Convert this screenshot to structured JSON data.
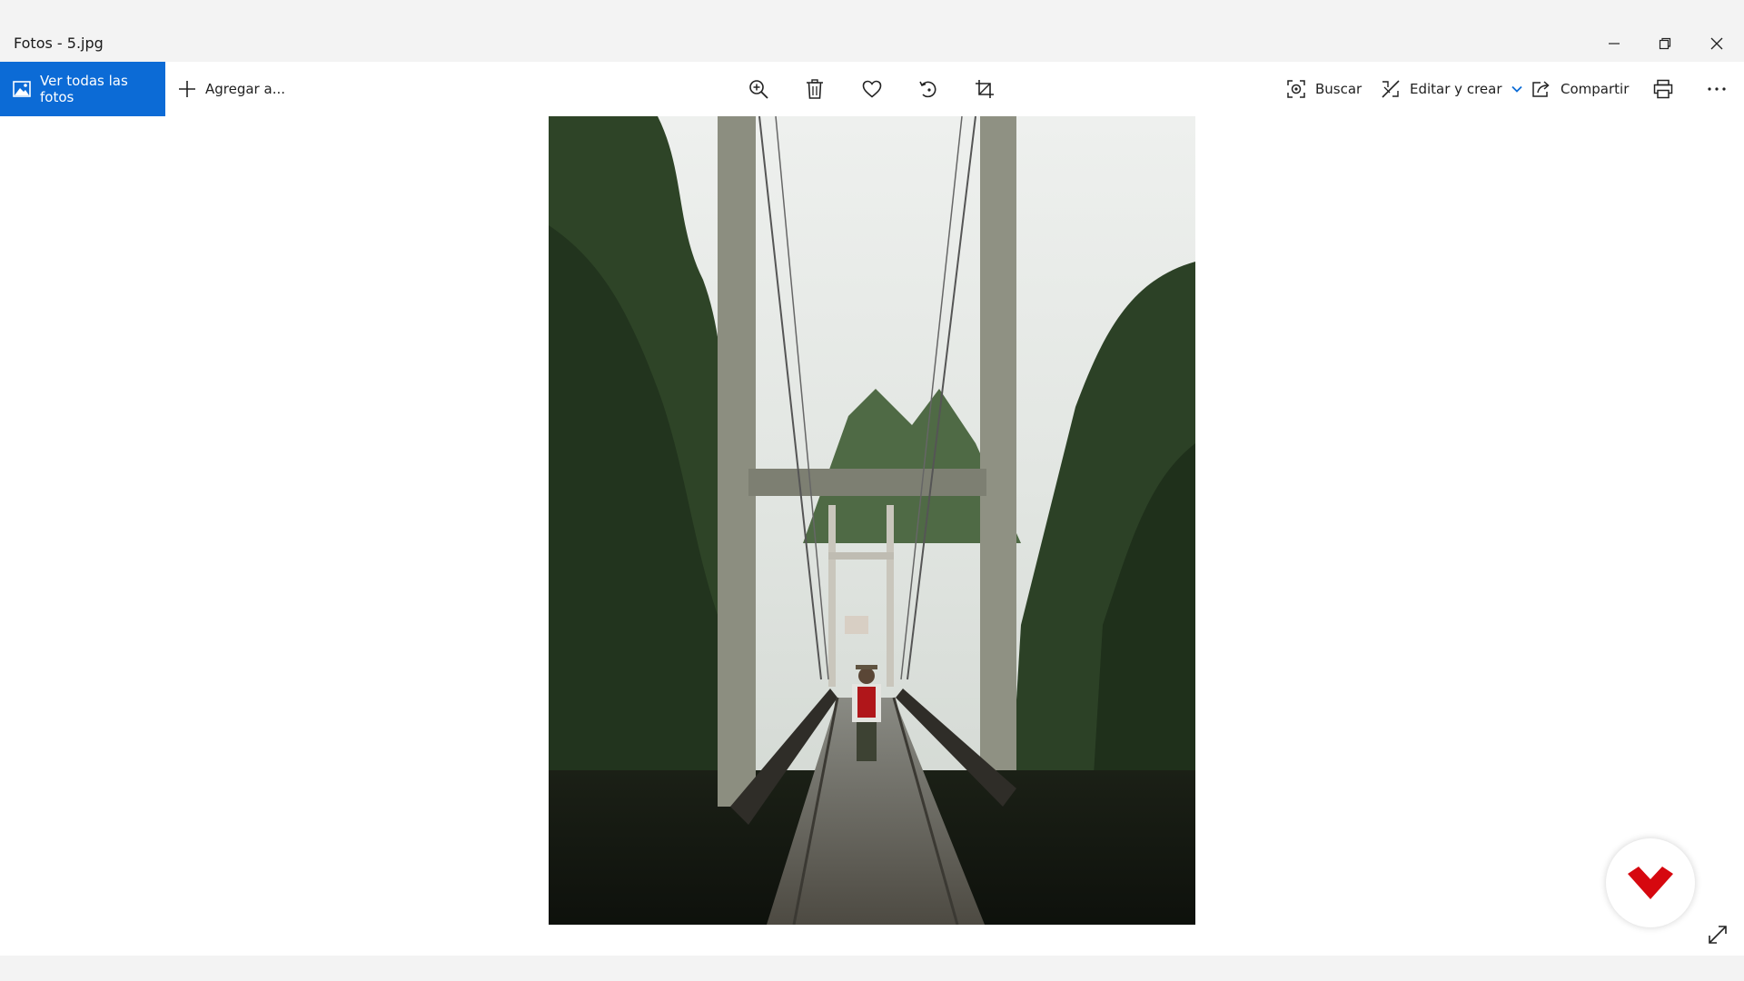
{
  "window": {
    "title": "Fotos - 5.jpg"
  },
  "toolbar": {
    "view_all_label": "Ver todas las fotos",
    "add_to_label": "Agregar a...",
    "search_label": "Buscar",
    "edit_create_label": "Editar y crear",
    "share_label": "Compartir"
  },
  "icons": {
    "gallery": "image-icon",
    "add": "plus-icon",
    "zoom": "zoom-in-icon",
    "delete": "trash-icon",
    "favorite": "heart-icon",
    "rotate": "rotate-icon",
    "crop": "crop-icon",
    "search": "visual-search-icon",
    "edit": "edit-create-icon",
    "share": "share-icon",
    "print": "printer-icon",
    "more": "more-icon",
    "expand": "expand-icon"
  },
  "colors": {
    "accent": "#0c6bd6",
    "logo_red": "#d6080f"
  }
}
